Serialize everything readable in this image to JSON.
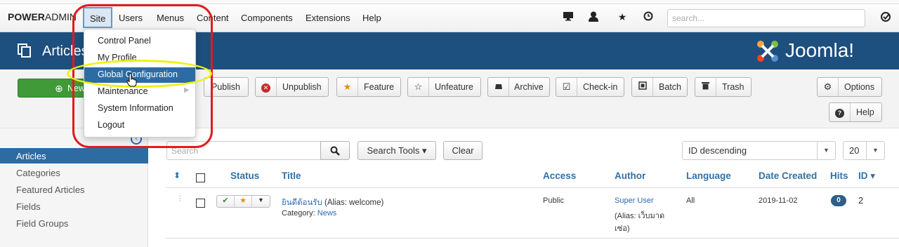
{
  "topnav": {
    "brand_bold": "POWER",
    "brand_rest": "ADMIN",
    "menus": [
      "Site",
      "Users",
      "Menus",
      "Content",
      "Components",
      "Extensions",
      "Help"
    ],
    "search_placeholder": "search..."
  },
  "site_menu": {
    "items": [
      "Control Panel",
      "My Profile",
      "Global Configuration",
      "Maintenance",
      "System Information",
      "Logout"
    ],
    "highlighted": "Global Configuration"
  },
  "header": {
    "title": "Articles",
    "logo_text": "Joomla!"
  },
  "toolbar": {
    "new_label": "New",
    "publish": "Publish",
    "unpublish": "Unpublish",
    "feature": "Feature",
    "unfeature": "Unfeature",
    "archive": "Archive",
    "checkin": "Check-in",
    "batch": "Batch",
    "trash": "Trash",
    "options": "Options",
    "help": "Help"
  },
  "sidebar": {
    "items": [
      "Articles",
      "Categories",
      "Featured Articles",
      "Fields",
      "Field Groups"
    ],
    "active": "Articles"
  },
  "filters": {
    "search_placeholder": "Search",
    "search_tools": "Search Tools",
    "clear": "Clear",
    "ordering": "ID descending",
    "limit": "20"
  },
  "table": {
    "headers": {
      "status": "Status",
      "title": "Title",
      "access": "Access",
      "author": "Author",
      "language": "Language",
      "date_created": "Date Created",
      "hits": "Hits",
      "id": "ID"
    },
    "rows": [
      {
        "title": "ยินดีต้อนรับ",
        "alias": "(Alias: welcome)",
        "category_label": "Category:",
        "category": "News",
        "access": "Public",
        "author": "Super User",
        "author_alias_1": "(Alias: เว็บมาด",
        "author_alias_2": "เซ่อ)",
        "language": "All",
        "date_created": "2019-11-02",
        "hits": "0",
        "id": "2"
      }
    ]
  },
  "colors": {
    "header_blue": "#1d4f7f",
    "active_blue": "#2d6ca2",
    "new_green": "#3f9a37",
    "annotation_red": "#e21b1b",
    "annotation_yellow": "#eef209"
  }
}
